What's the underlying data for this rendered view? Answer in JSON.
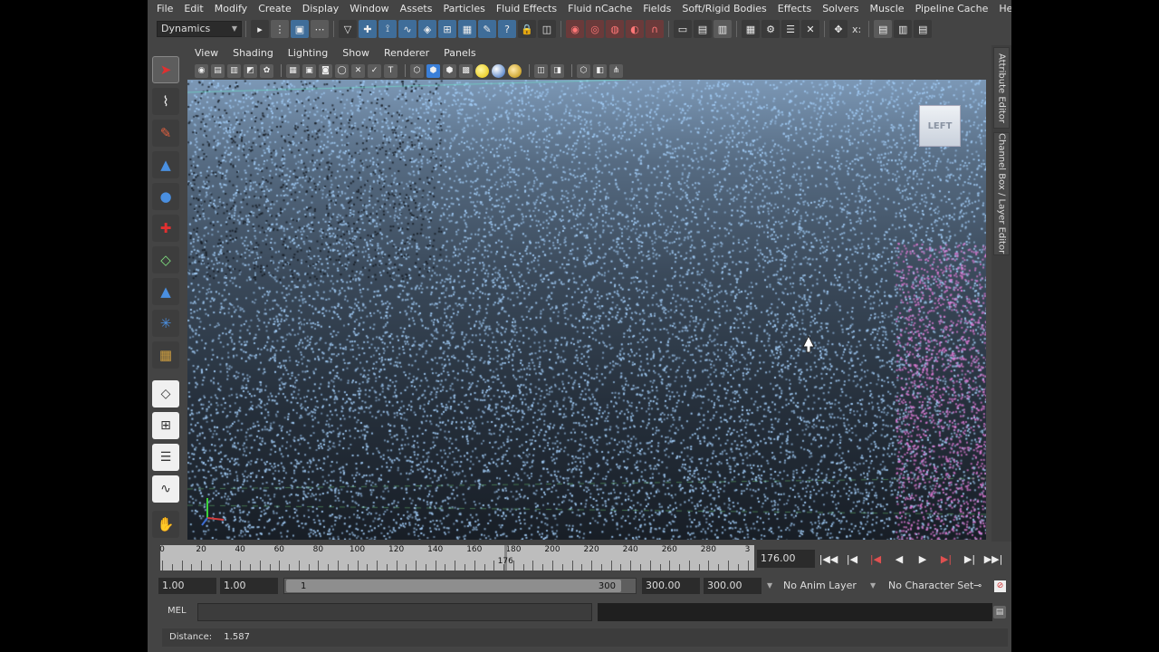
{
  "menubar": [
    "File",
    "Edit",
    "Modify",
    "Create",
    "Display",
    "Window",
    "Assets",
    "Particles",
    "Fluid Effects",
    "Fluid nCache",
    "Fields",
    "Soft/Rigid Bodies",
    "Effects",
    "Solvers",
    "Muscle",
    "Pipeline Cache",
    "Help"
  ],
  "statusline": {
    "menu_set": "Dynamics",
    "symmetry_label": "x:"
  },
  "panel": {
    "menus": [
      "View",
      "Shading",
      "Lighting",
      "Show",
      "Renderer",
      "Panels"
    ]
  },
  "viewport": {
    "viewcube_label": "LEFT",
    "background_top": "#7c98b6",
    "background_bottom": "#181e26",
    "particle_color": "#9ec8f2",
    "particle_accent_color": "#e07cd8"
  },
  "right_tabs": {
    "attribute_editor": "Attribute Editor",
    "channel_box": "Channel Box / Layer Editor"
  },
  "timeslider": {
    "tick_labels": [
      "0",
      "20",
      "40",
      "60",
      "80",
      "100",
      "120",
      "140",
      "160",
      "180",
      "200",
      "220",
      "240",
      "260",
      "280",
      "3"
    ],
    "current_frame_label": "176",
    "current_frame_field": "176.00"
  },
  "rangeslider": {
    "start_time": "1.00",
    "playback_start": "1.00",
    "range_start_label": "1",
    "range_end_label": "300",
    "playback_end": "300.00",
    "end_time": "300.00",
    "anim_layer": "No Anim Layer",
    "character_set": "No Character Set"
  },
  "cmdline": {
    "label": "MEL"
  },
  "helpline": {
    "label": "Distance:",
    "value": "1.587"
  }
}
